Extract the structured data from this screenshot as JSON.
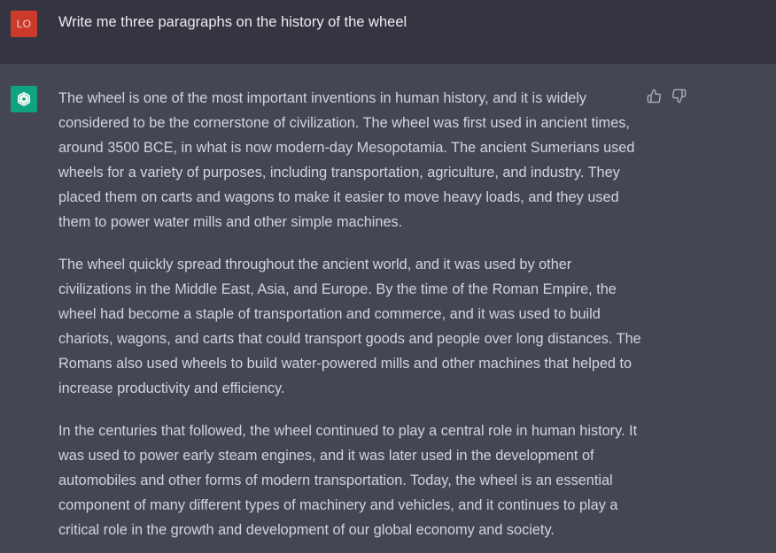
{
  "user_message": {
    "avatar_initials": "LO",
    "text": "Write me three paragraphs on the history of the wheel"
  },
  "assistant_message": {
    "avatar_icon": "openai-logo-icon",
    "paragraphs": [
      "The wheel is one of the most important inventions in human history, and it is widely considered to be the cornerstone of civilization. The wheel was first used in ancient times, around 3500 BCE, in what is now modern-day Mesopotamia. The ancient Sumerians used wheels for a variety of purposes, including transportation, agriculture, and industry. They placed them on carts and wagons to make it easier to move heavy loads, and they used them to power water mills and other simple machines.",
      "The wheel quickly spread throughout the ancient world, and it was used by other civilizations in the Middle East, Asia, and Europe. By the time of the Roman Empire, the wheel had become a staple of transportation and commerce, and it was used to build chariots, wagons, and carts that could transport goods and people over long distances. The Romans also used wheels to build water-powered mills and other machines that helped to increase productivity and efficiency.",
      "In the centuries that followed, the wheel continued to play a central role in human history. It was used to power early steam engines, and it was later used in the development of automobiles and other forms of modern transportation. Today, the wheel is an essential component of many different types of machinery and vehicles, and it continues to play a critical role in the growth and development of our global economy and society."
    ],
    "feedback_icons": [
      "thumbs-up-icon",
      "thumbs-down-icon"
    ]
  },
  "colors": {
    "user_background": "#343541",
    "assistant_background": "#444654",
    "user_avatar": "#cc3a2b",
    "assistant_avatar": "#10a37f",
    "text": "#d1d5db"
  }
}
